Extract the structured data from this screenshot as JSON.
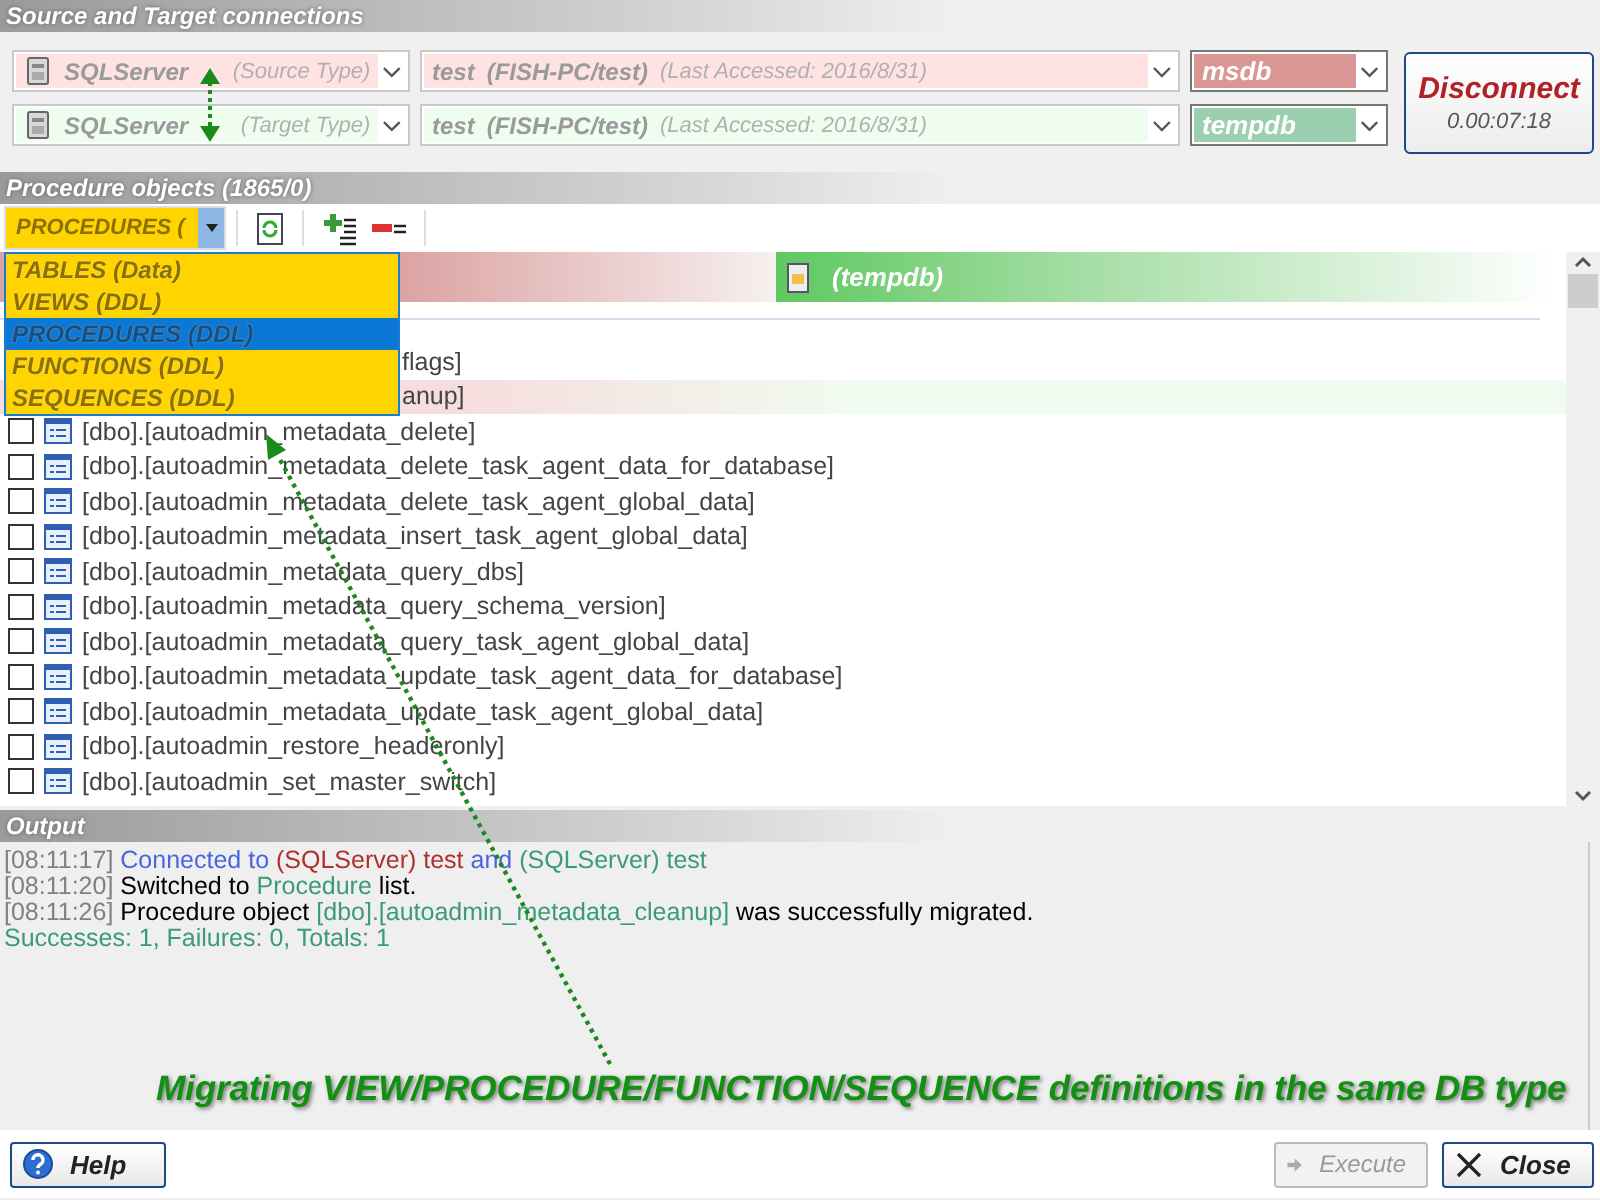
{
  "sections": {
    "connections": "Source and Target connections",
    "objects": "Procedure objects (1865/0)",
    "output": "Output"
  },
  "connections": [
    {
      "db_type": "SQLServer",
      "type_hint": "(Source Type)",
      "name": "test",
      "host": "(FISH-PC/test)",
      "last_accessed": "(Last Accessed: 2016/8/31)",
      "database": {
        "name": "msdb",
        "color": "#d99694"
      },
      "color": "#ffe3e3"
    },
    {
      "db_type": "SQLServer",
      "type_hint": "(Target Type)",
      "name": "test",
      "host": "(FISH-PC/test)",
      "last_accessed": "(Last Accessed: 2016/8/31)",
      "database": {
        "name": "tempdb",
        "color": "#9ccfb0"
      },
      "color": "#effdef"
    }
  ],
  "disconnect": {
    "label": "Disconnect",
    "elapsed": "0.00:07:18"
  },
  "object_type": {
    "value": "PROCEDURES (",
    "options": [
      {
        "label": "TABLES (Data)",
        "selected": false
      },
      {
        "label": "VIEWS (DDL)",
        "selected": false
      },
      {
        "label": "PROCEDURES (DDL)",
        "selected": true
      },
      {
        "label": "FUNCTIONS (DDL)",
        "selected": false
      },
      {
        "label": "SEQUENCES (DDL)",
        "selected": false
      }
    ]
  },
  "target_header": "(tempdb)",
  "objects": [
    {
      "kind": "partial",
      "text": "flags]",
      "selected": false
    },
    {
      "kind": "partial",
      "text": "anup]",
      "selected": true
    },
    {
      "kind": "item",
      "text": "[dbo].[autoadmin_metadata_delete]",
      "checked": false,
      "selected": false
    },
    {
      "kind": "item",
      "text": "[dbo].[autoadmin_metadata_delete_task_agent_data_for_database]",
      "checked": false,
      "selected": false
    },
    {
      "kind": "item",
      "text": "[dbo].[autoadmin_metadata_delete_task_agent_global_data]",
      "checked": false,
      "selected": false
    },
    {
      "kind": "item",
      "text": "[dbo].[autoadmin_metadata_insert_task_agent_global_data]",
      "checked": false,
      "selected": false
    },
    {
      "kind": "item",
      "text": "[dbo].[autoadmin_metadata_query_dbs]",
      "checked": false,
      "selected": false
    },
    {
      "kind": "item",
      "text": "[dbo].[autoadmin_metadata_query_schema_version]",
      "checked": false,
      "selected": false
    },
    {
      "kind": "item",
      "text": "[dbo].[autoadmin_metadata_query_task_agent_global_data]",
      "checked": false,
      "selected": false
    },
    {
      "kind": "item",
      "text": "[dbo].[autoadmin_metadata_update_task_agent_data_for_database]",
      "checked": false,
      "selected": false
    },
    {
      "kind": "item",
      "text": "[dbo].[autoadmin_metadata_update_task_agent_global_data]",
      "checked": false,
      "selected": false
    },
    {
      "kind": "item",
      "text": "[dbo].[autoadmin_restore_headeronly]",
      "checked": false,
      "selected": false
    },
    {
      "kind": "item",
      "text": "[dbo].[autoadmin_set_master_switch]",
      "checked": false,
      "selected": false
    }
  ],
  "output": [
    {
      "segments": [
        {
          "text": "[08:11:17] ",
          "color": "#808080"
        },
        {
          "text": "Connected to ",
          "color": "#4a66dd"
        },
        {
          "text": "(SQLServer) test ",
          "color": "#b0302a"
        },
        {
          "text": "and ",
          "color": "#4a66dd"
        },
        {
          "text": "(SQLServer) test",
          "color": "#3a9a7a"
        }
      ]
    },
    {
      "segments": [
        {
          "text": "[08:11:20] ",
          "color": "#808080"
        },
        {
          "text": "Switched to ",
          "color": "#000000"
        },
        {
          "text": "Procedure",
          "color": "#3a9a7a"
        },
        {
          "text": " list.",
          "color": "#000000"
        }
      ]
    },
    {
      "segments": [
        {
          "text": "[08:11:26] ",
          "color": "#808080"
        },
        {
          "text": "Procedure object ",
          "color": "#000000"
        },
        {
          "text": "[dbo].[autoadmin_metadata_cleanup]",
          "color": "#3a9a7a"
        },
        {
          "text": " was successfully migrated.",
          "color": "#000000"
        }
      ]
    },
    {
      "segments": [
        {
          "text": "Successes: 1, Failures: 0, Totals: 1",
          "color": "#3a9a7a"
        }
      ]
    }
  ],
  "annotation": "Migrating VIEW/PROCEDURE/FUNCTION/SEQUENCE definitions in the same DB type",
  "buttons": [
    {
      "kind": "help",
      "label": "Help",
      "disabled": false
    },
    {
      "kind": "execute",
      "label": "Execute",
      "disabled": true
    },
    {
      "kind": "close",
      "label": "Close",
      "disabled": false
    }
  ]
}
